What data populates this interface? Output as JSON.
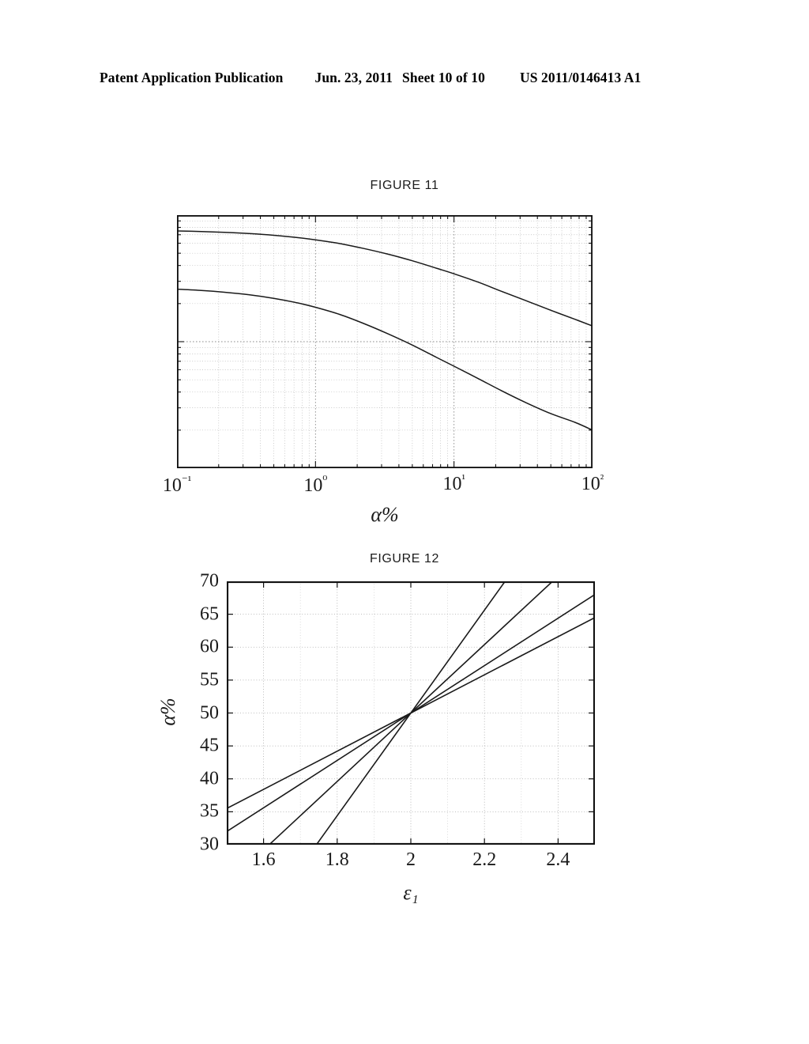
{
  "header": {
    "publication": "Patent Application Publication",
    "date": "Jun. 23, 2011",
    "sheet": "Sheet 10 of 10",
    "document_number": "US 2011/0146413 A1"
  },
  "figures": [
    {
      "id": "figure-11",
      "title": "FIGURE 11",
      "xlabel": "α%",
      "ylabel": ""
    },
    {
      "id": "figure-12",
      "title": "FIGURE 12",
      "xlabel": "ε₁",
      "ylabel": "α%"
    }
  ],
  "chart_data": [
    {
      "type": "line",
      "title": "FIGURE 11",
      "xlabel": "α%",
      "ylabel": "",
      "xscale": "log",
      "yscale": "log",
      "xlim": [
        0.1,
        100
      ],
      "ylim": [
        1,
        100
      ],
      "grid": true,
      "legend": "none",
      "xticks": [
        0.1,
        1,
        10,
        100
      ],
      "xticklabels": [
        "10⁻¹",
        "10⁰",
        "10¹",
        "10²"
      ],
      "yticklabels": [],
      "series": [
        {
          "name": "upper curve",
          "x": [
            0.1,
            0.15,
            0.22,
            0.33,
            0.5,
            0.75,
            1.0,
            1.5,
            2.2,
            3.3,
            5.0,
            7.5,
            10.0,
            15.0,
            22.0,
            33.0,
            50.0,
            75.0,
            100.0
          ],
          "y": [
            75.0,
            74.2,
            73.1,
            71.5,
            69.3,
            66.4,
            63.8,
            59.6,
            54.7,
            49.3,
            43.6,
            38.0,
            34.4,
            29.5,
            25.0,
            21.1,
            17.7,
            15.0,
            13.3
          ]
        },
        {
          "name": "lower curve",
          "x": [
            0.1,
            0.15,
            0.22,
            0.33,
            0.5,
            0.75,
            1.0,
            1.5,
            2.2,
            3.3,
            5.0,
            7.5,
            10.0,
            15.0,
            22.0,
            33.0,
            50.0,
            75.0,
            100.0
          ],
          "y": [
            26.0,
            25.4,
            24.6,
            23.5,
            22.0,
            20.2,
            18.7,
            16.4,
            14.0,
            11.6,
            9.4,
            7.5,
            6.4,
            5.1,
            4.1,
            3.3,
            2.7,
            2.3,
            2.0
          ]
        }
      ]
    },
    {
      "type": "line",
      "title": "FIGURE 12",
      "xlabel": "ε₁",
      "ylabel": "α%",
      "xscale": "linear",
      "yscale": "linear",
      "xlim": [
        1.5,
        2.5
      ],
      "ylim": [
        30,
        70
      ],
      "grid": true,
      "legend": "none",
      "xticks": [
        1.6,
        1.8,
        2,
        2.2,
        2.4
      ],
      "xticklabels": [
        "1.6",
        "1.8",
        "2",
        "2.2",
        "2.4"
      ],
      "yticks": [
        30,
        35,
        40,
        45,
        50,
        55,
        60,
        65,
        70
      ],
      "yticklabels": [
        "30",
        "35",
        "40",
        "45",
        "50",
        "55",
        "60",
        "65",
        "70"
      ],
      "crossing_point": [
        2,
        50
      ],
      "series": [
        {
          "name": "line-1-steepest",
          "slope": 78.0,
          "x": [
            1.5,
            2.0,
            2.256
          ],
          "y": [
            11.0,
            50.0,
            70.0
          ]
        },
        {
          "name": "line-2-steep",
          "slope": 52.0,
          "x": [
            1.5,
            2.0,
            2.385
          ],
          "y": [
            24.0,
            50.0,
            70.0
          ]
        },
        {
          "name": "line-3-shallow",
          "slope": 36.0,
          "x": [
            1.5,
            2.0,
            2.5
          ],
          "y": [
            32.0,
            50.0,
            68.0
          ]
        },
        {
          "name": "line-4-shallowest",
          "slope": 29.0,
          "x": [
            1.5,
            2.0,
            2.5
          ],
          "y": [
            35.5,
            50.0,
            64.5
          ]
        }
      ]
    }
  ]
}
